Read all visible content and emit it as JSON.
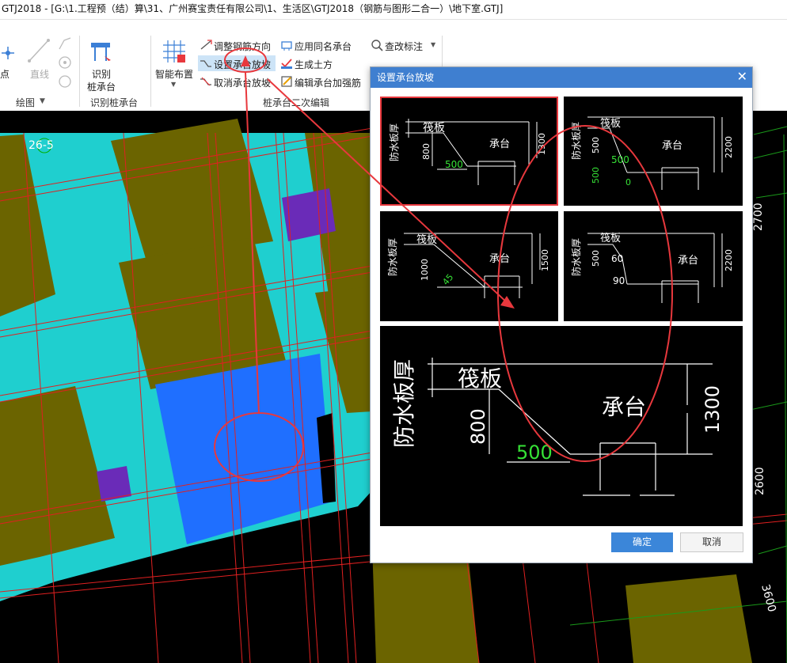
{
  "window": {
    "title": "GTJ2018 - [G:\\1.工程预（结）算\\31、广州赛宝责任有限公司\\1、生活区\\GTJ2018（钢筋与图形二合一）\\地下室.GTJ]"
  },
  "ribbon": {
    "draw": {
      "point": "点",
      "line": "直线",
      "group_label": "绘图"
    },
    "identify_pile": {
      "label_line1": "识别",
      "label_line2": "桩承台",
      "group_label": "识别桩承台"
    },
    "smart_layout": {
      "label": "智能布置"
    },
    "edit": {
      "adjust_rebar": "调整钢筋方向",
      "set_slope": "设置承台放坡",
      "cancel_slope": "取消承台放坡",
      "apply_same_name": "应用同名承台",
      "gen_earthwork": "生成土方",
      "edit_rebar": "编辑承台加强筋",
      "check_mark": "查改标注",
      "group_label": "桩承台二次编辑"
    }
  },
  "canvas": {
    "labels": {
      "axis_26_5": "26-5",
      "dim_2700": "2700",
      "dim_2600": "2600",
      "dim_3600": "3600"
    }
  },
  "dialog": {
    "title": "设置承台放坡",
    "close_icon": "close-icon",
    "options": [
      {
        "thick_label": "防水板厚",
        "raft": "筏板",
        "cap": "承台",
        "d1": "800",
        "d2": "500",
        "d3": "1300",
        "selected": true
      },
      {
        "thick_label": "防水板厚",
        "raft": "筏板",
        "cap": "承台",
        "d1": "500",
        "d2": "500",
        "d3": "2200",
        "d4": "500",
        "d5": "0"
      },
      {
        "thick_label": "防水板厚",
        "raft": "筏板",
        "cap": "承台",
        "d1": "1000",
        "d2": "45",
        "d3": "1500"
      },
      {
        "thick_label": "防水板厚",
        "raft": "筏板",
        "cap": "承台",
        "d1": "500",
        "d2": "60",
        "d3": "2200",
        "d4": "90"
      }
    ],
    "preview": {
      "thick_label": "防水板厚",
      "raft": "筏板",
      "cap": "承台",
      "d1": "800",
      "d2": "500",
      "d3": "1300"
    },
    "ok": "确定",
    "cancel": "取消"
  },
  "colors": {
    "teal": "#1fcfcf",
    "olive": "#6b6400",
    "blue": "#1f6fff",
    "purple": "#6a2bb8",
    "annot_red": "#e8383d",
    "accent": "#3b86d9"
  }
}
